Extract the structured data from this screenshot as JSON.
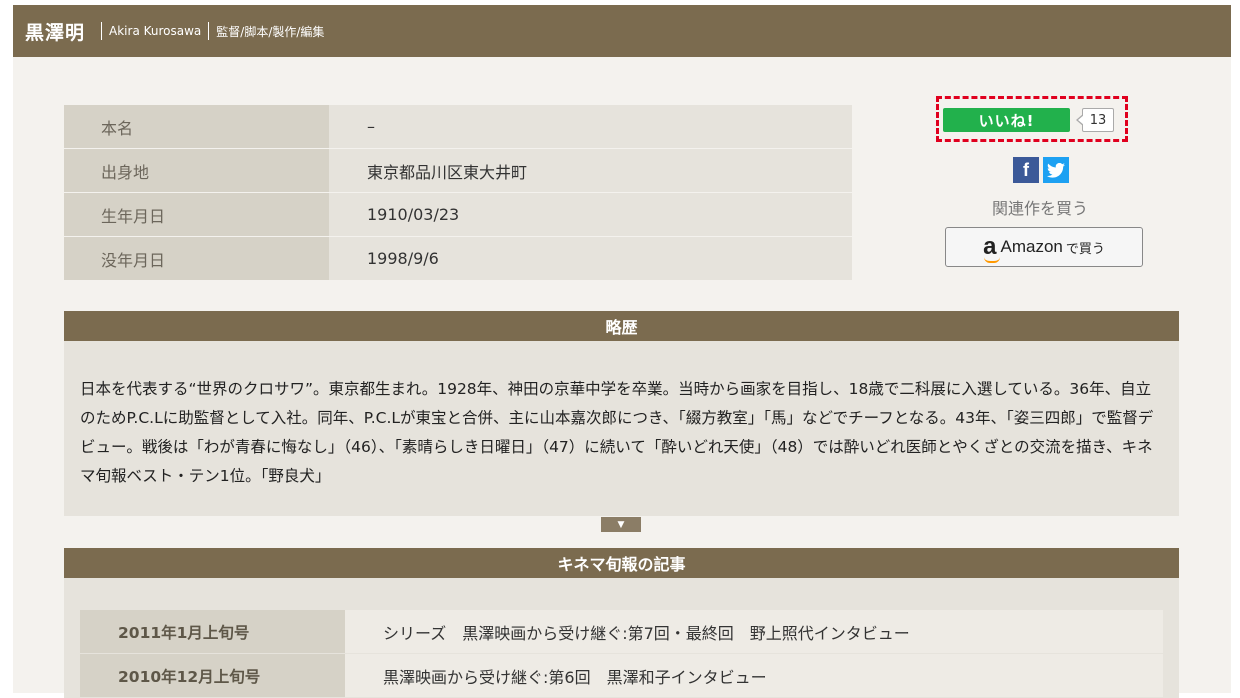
{
  "header": {
    "name": "黒澤明",
    "romaji": "Akira Kurosawa",
    "roles": "監督/脚本/製作/編集"
  },
  "profile": [
    {
      "label": "本名",
      "value": "–"
    },
    {
      "label": "出身地",
      "value": "東京都品川区東大井町"
    },
    {
      "label": "生年月日",
      "value": "1910/03/23"
    },
    {
      "label": "没年月日",
      "value": "1998/9/6"
    }
  ],
  "like": {
    "label": "いいね!",
    "count": "13"
  },
  "social": {
    "facebook_glyph": "f",
    "twitter_glyph": "🐦"
  },
  "related": {
    "label": "関連作を買う"
  },
  "amazon": {
    "logo": "a",
    "brand": "Amazon",
    "suffix": "で買う"
  },
  "bio": {
    "title": "略歴",
    "text": "日本を代表する“世界のクロサワ”。東京都生まれ。1928年、神田の京華中学を卒業。当時から画家を目指し、18歳で二科展に入選している。36年、自立のためP.C.Lに助監督として入社。同年、P.C.Lが東宝と合併、主に山本嘉次郎につき、「綴方教室」「馬」などでチーフとなる。43年、「姿三四郎」で監督デビュー。戦後は「わが青春に悔なし」（46）、「素晴らしき日曜日」（47）に続いて「酔いどれ天使」（48）では酔いどれ医師とやくざとの交流を描き、キネマ旬報ベスト・テン1位。「野良犬」",
    "expand_glyph": "▼"
  },
  "articles": {
    "title": "キネマ旬報の記事",
    "rows": [
      {
        "date": "2011年1月上旬号",
        "title": "シリーズ　黒澤映画から受け継ぐ:第7回・最終回　野上照代インタビュー"
      },
      {
        "date": "2010年12月上旬号",
        "title": "黒澤映画から受け継ぐ:第6回　黒澤和子インタビュー"
      }
    ]
  }
}
